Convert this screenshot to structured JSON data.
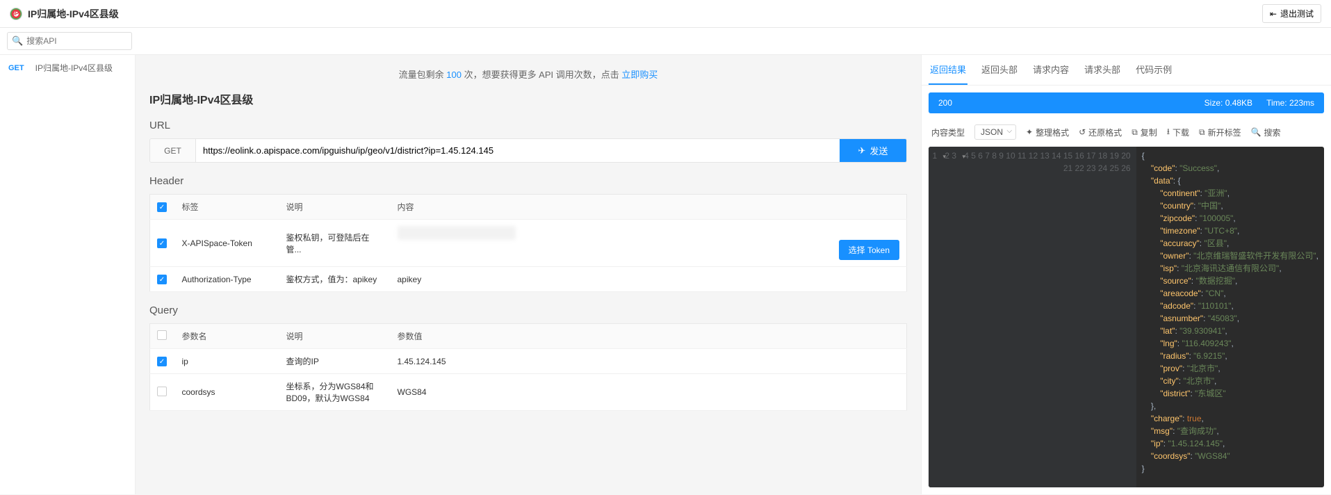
{
  "topbar": {
    "title": "IP归属地-IPv4区县级",
    "exit": "退出测试"
  },
  "sidebar": {
    "search_placeholder": "搜索API",
    "items": [
      {
        "method": "GET",
        "name": "IP归属地-IPv4区县级"
      }
    ]
  },
  "banner": {
    "prefix": "流量包剩余 ",
    "count": "100",
    "mid": " 次，想要获得更多 API 调用次数，点击 ",
    "link": "立即购买"
  },
  "page_title": "IP归属地-IPv4区县级",
  "url_section": {
    "label": "URL",
    "method": "GET",
    "value": "https://eolink.o.apispace.com/ipguishu/ip/geo/v1/district?ip=1.45.124.145",
    "send": "发送"
  },
  "header_section": {
    "label": "Header",
    "cols": [
      "标签",
      "说明",
      "内容"
    ],
    "rows": [
      {
        "checked": true,
        "tag": "X-APISpace-Token",
        "desc": "鉴权私钥，可登陆后在管...",
        "content": "",
        "token_btn": "选择 Token"
      },
      {
        "checked": true,
        "tag": "Authorization-Type",
        "desc": "鉴权方式，值为：apikey",
        "content": "apikey"
      }
    ]
  },
  "query_section": {
    "label": "Query",
    "cols": [
      "参数名",
      "说明",
      "参数值"
    ],
    "rows": [
      {
        "checked": true,
        "name": "ip",
        "desc": "查询的IP",
        "value": "1.45.124.145"
      },
      {
        "checked": false,
        "name": "coordsys",
        "desc": "坐标系，分为WGS84和BD09，默认为WGS84",
        "value": "WGS84"
      }
    ]
  },
  "results": {
    "tabs": [
      "返回结果",
      "返回头部",
      "请求内容",
      "请求头部",
      "代码示例"
    ],
    "status_code": "200",
    "size_label": "Size:",
    "size_value": "0.48KB",
    "time_label": "Time:",
    "time_value": "223ms",
    "content_type_label": "内容类型",
    "content_type_value": "JSON",
    "tools": {
      "tidy": "整理格式",
      "restore": "还原格式",
      "copy": "复制",
      "download": "下载",
      "newtab": "新开标签",
      "search": "搜索"
    },
    "json": {
      "code": "Success",
      "data": {
        "continent": "亚洲",
        "country": "中国",
        "zipcode": "100005",
        "timezone": "UTC+8",
        "accuracy": "区县",
        "owner": "北京维瑞智盛软件开发有限公司",
        "isp": "北京海讯达通信有限公司",
        "source": "数据挖掘",
        "areacode": "CN",
        "adcode": "110101",
        "asnumber": "45083",
        "lat": "39.930941",
        "lng": "116.409243",
        "radius": "6.9215",
        "prov": "北京市",
        "city": "北京市",
        "district": "东城区"
      },
      "charge": true,
      "msg": "查询成功",
      "ip": "1.45.124.145",
      "coordsys": "WGS84"
    }
  }
}
